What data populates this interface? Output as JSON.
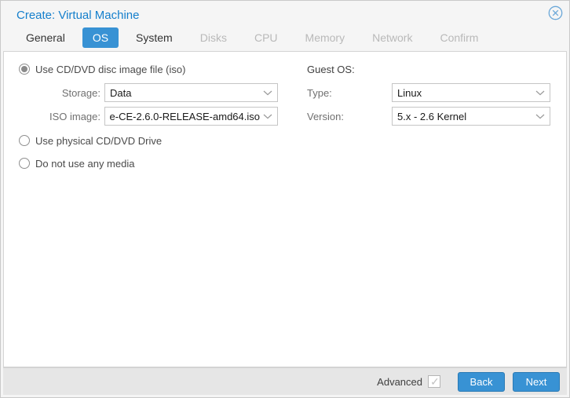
{
  "colors": {
    "accent": "#3892d4",
    "title": "#157fcc",
    "disabled_tab": "#b9b9b9",
    "footer_bg": "#e6e6e6"
  },
  "icons": {
    "close": "circle-x-icon",
    "dropdown": "chevron-down-icon"
  },
  "dialog": {
    "title": "Create: Virtual Machine"
  },
  "tabs": [
    {
      "label": "General",
      "state": "enabled"
    },
    {
      "label": "OS",
      "state": "selected"
    },
    {
      "label": "System",
      "state": "enabled"
    },
    {
      "label": "Disks",
      "state": "disabled"
    },
    {
      "label": "CPU",
      "state": "disabled"
    },
    {
      "label": "Memory",
      "state": "disabled"
    },
    {
      "label": "Network",
      "state": "disabled"
    },
    {
      "label": "Confirm",
      "state": "disabled"
    }
  ],
  "media": {
    "radios": [
      {
        "label": "Use CD/DVD disc image file (iso)",
        "selected": true
      },
      {
        "label": "Use physical CD/DVD Drive",
        "selected": false
      },
      {
        "label": "Do not use any media",
        "selected": false
      }
    ],
    "storage": {
      "label": "Storage:",
      "value": "Data"
    },
    "iso_image": {
      "label": "ISO image:",
      "value": "e-CE-2.6.0-RELEASE-amd64.iso"
    }
  },
  "guest_os": {
    "heading": "Guest OS:",
    "type": {
      "label": "Type:",
      "value": "Linux"
    },
    "version": {
      "label": "Version:",
      "value": "5.x - 2.6 Kernel"
    }
  },
  "footer": {
    "advanced_label": "Advanced",
    "advanced_checked": true,
    "back_label": "Back",
    "next_label": "Next"
  }
}
